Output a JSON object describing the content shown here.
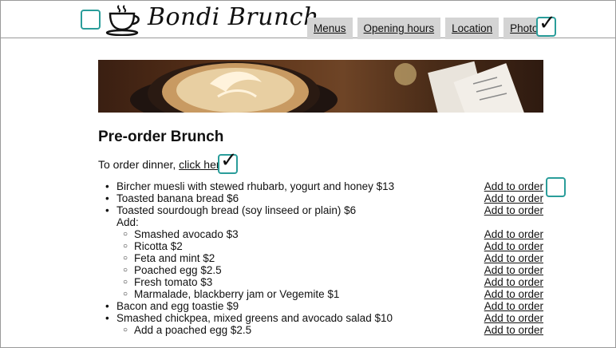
{
  "brand": {
    "name": "Bondi Brunch",
    "logo_icon": "coffee-cup-icon"
  },
  "nav": {
    "items": [
      {
        "label": "Menus"
      },
      {
        "label": "Opening hours"
      },
      {
        "label": "Location"
      },
      {
        "label": "Photos"
      }
    ]
  },
  "main": {
    "title": "Pre-order Brunch",
    "dinner_prefix": "To order dinner, ",
    "dinner_link": "click here",
    "dinner_suffix": ".",
    "order_label": "Add to order",
    "items": [
      {
        "text": "Bircher muesli with stewed rhubarb, yogurt and honey $13"
      },
      {
        "text": "Toasted banana bread $6"
      },
      {
        "text": "Toasted sourdough bread (soy linseed or plain) $6"
      },
      {
        "text": "Add:"
      },
      {
        "text": "Smashed avocado $3"
      },
      {
        "text": "Ricotta $2"
      },
      {
        "text": "Feta and mint $2"
      },
      {
        "text": "Poached egg $2.5"
      },
      {
        "text": "Fresh tomato $3"
      },
      {
        "text": "Marmalade, blackberry jam or Vegemite $1"
      },
      {
        "text": "Bacon and egg toastie $9"
      },
      {
        "text": "Smashed chickpea, mixed greens and avocado salad $10"
      },
      {
        "text": "Add a poached egg $2.5"
      }
    ]
  },
  "colors": {
    "accent": "#2a9d9a",
    "tab_bg": "#d4d4d4",
    "text": "#111111"
  }
}
